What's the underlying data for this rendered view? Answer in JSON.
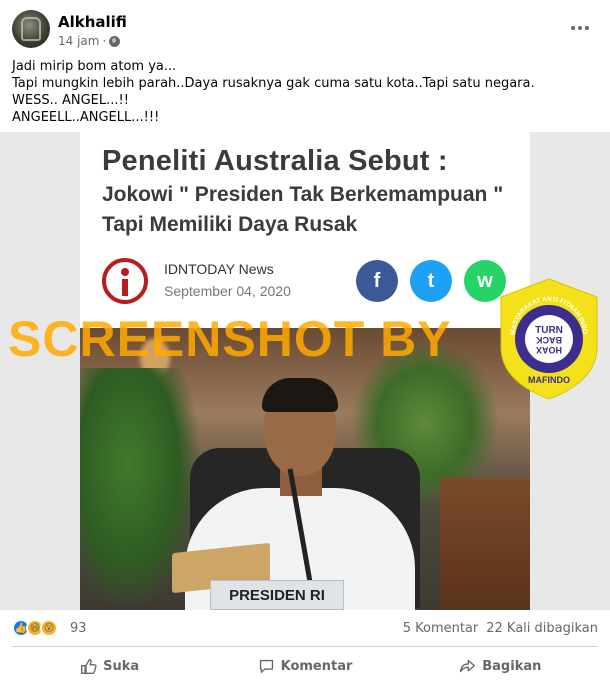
{
  "post": {
    "author": "Alkhalifi",
    "time": "14 jam",
    "separator": "·",
    "text_lines": [
      "Jadi mirip bom atom ya...",
      "Tapi mungkin lebih parah..Daya rusaknya gak cuma satu kota..Tapi satu negara.",
      "WESS.. ANGEL...!!",
      "ANGEELL..ANGELL...!!!"
    ]
  },
  "image": {
    "headline_line1": "Peneliti Australia Sebut :",
    "headline_line2": "Jokowi \" Presiden Tak Berkemampuan \"",
    "headline_line3": "Tapi Memiliki Daya Rusak",
    "source_name": "IDNTODAY News",
    "source_date": "September 04, 2020",
    "share_icons": [
      "facebook-icon",
      "twitter-icon",
      "whatsapp-icon"
    ],
    "share_glyphs": [
      "f",
      "t",
      "w"
    ],
    "watermark": "SCREENSHOT BY",
    "nameplate": "PRESIDEN RI",
    "badge": {
      "arc_text": "MASYARAKAT ANTI FITNAH INDONESIA",
      "center_line1": "TURN",
      "center_line2": "BACK",
      "center_line3": "HOAX",
      "bottom_text": "MAFINDO"
    }
  },
  "stats": {
    "reactions_count": "93",
    "comments": "5 Komentar",
    "shares": "22 Kali dibagikan"
  },
  "actions": {
    "like": "Suka",
    "comment": "Komentar",
    "share": "Bagikan"
  },
  "colors": {
    "facebook_blue": "#1877f2",
    "watermark_orange": "#ffaa00",
    "badge_yellow": "#f5e11a",
    "badge_purple": "#3d2d8c"
  }
}
